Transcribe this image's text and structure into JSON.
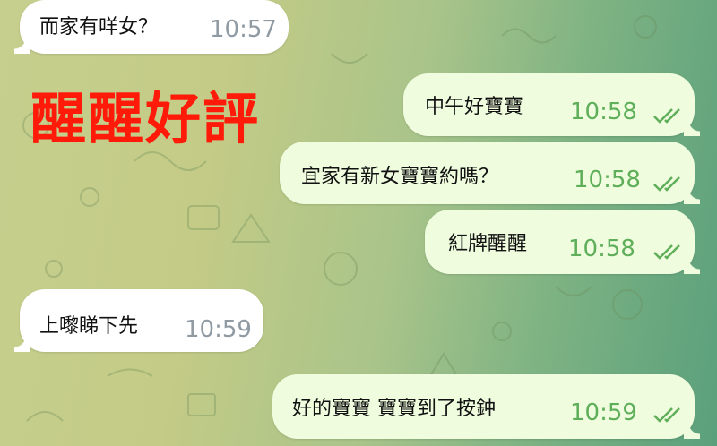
{
  "overlay": {
    "caption": "醒醒好評"
  },
  "colors": {
    "incoming_bubble": "#ffffff",
    "outgoing_bubble": "#effdde",
    "time_out": "#5fae5a",
    "time_in": "#8f9aa3",
    "caption": "#ff1a0a"
  },
  "messages": [
    {
      "direction": "in",
      "text": "而家有咩女？",
      "time": "10:57"
    },
    {
      "direction": "out",
      "text": "中午好寶寶",
      "time": "10:58",
      "status": "read"
    },
    {
      "direction": "out",
      "text": "宜家有新女寶寶約嗎？",
      "time": "10:58",
      "status": "read"
    },
    {
      "direction": "out",
      "text": "紅牌醒醒",
      "time": "10:58",
      "status": "read"
    },
    {
      "direction": "in",
      "text": "上嚟睇下先",
      "time": "10:59"
    },
    {
      "direction": "out",
      "text": "好的寶寶 寶寶到了按鈡",
      "time": "10:59",
      "status": "read"
    }
  ]
}
